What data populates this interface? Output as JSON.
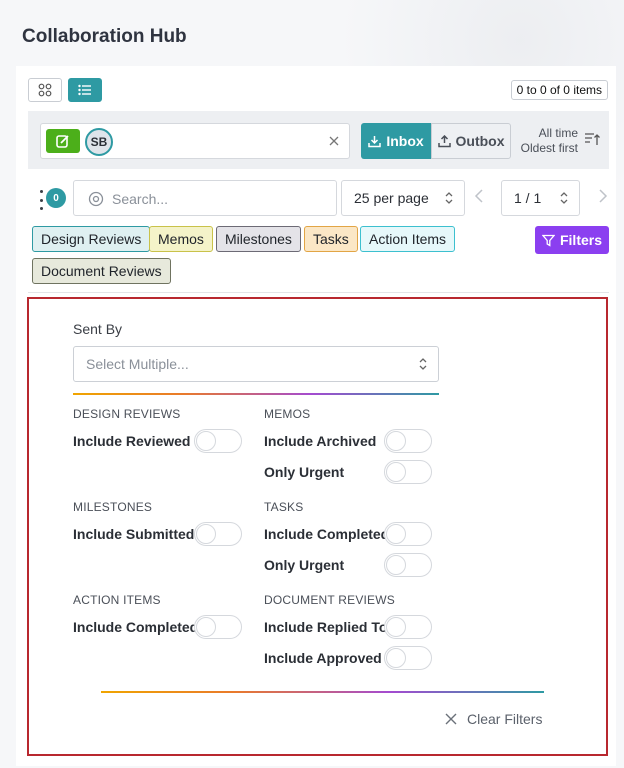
{
  "app": {
    "title": "Collaboration Hub"
  },
  "toolbar": {
    "items_count": "0 to 0 of 0 items",
    "accent_color": "#2e9aa3"
  },
  "recipients": {
    "avatar_initials": "SB",
    "inbox_label": "Inbox",
    "outbox_label": "Outbox",
    "sort_range": "All time",
    "sort_order": "Oldest first"
  },
  "search": {
    "placeholder": "Search...",
    "value": "",
    "filter_count": "0"
  },
  "pagination": {
    "per_page": "25 per page",
    "page": "1 / 1"
  },
  "chips": [
    {
      "label": "Design Reviews",
      "bg": "#dff0f1",
      "border": "#2e9aa3"
    },
    {
      "label": "Memos",
      "bg": "#f4f3c9",
      "border": "#c9c24a"
    },
    {
      "label": "Milestones",
      "bg": "#e4e3e8",
      "border": "#6c6a75"
    },
    {
      "label": "Tasks",
      "bg": "#fbe7c6",
      "border": "#e2a545"
    },
    {
      "label": "Action Items",
      "bg": "#e6f8fa",
      "border": "#3cc0cf"
    },
    {
      "label": "Document Reviews",
      "bg": "#e7e9dc",
      "border": "#6f7360"
    }
  ],
  "filters_button": {
    "label": "Filters",
    "color": "#8b3ff0"
  },
  "filter_panel": {
    "sent_by_label": "Sent By",
    "sent_by_placeholder": "Select Multiple...",
    "sections": {
      "design_reviews": {
        "title": "DESIGN REVIEWS",
        "options": [
          "Include Reviewed"
        ]
      },
      "memos": {
        "title": "MEMOS",
        "options": [
          "Include Archived",
          "Only Urgent"
        ]
      },
      "milestones": {
        "title": "MILESTONES",
        "options": [
          "Include Submitted"
        ]
      },
      "tasks": {
        "title": "TASKS",
        "options": [
          "Include Completed",
          "Only Urgent"
        ]
      },
      "action_items": {
        "title": "ACTION ITEMS",
        "options": [
          "Include Completed"
        ]
      },
      "document_reviews": {
        "title": "DOCUMENT REVIEWS",
        "options": [
          "Include Replied To",
          "Include Approved"
        ]
      }
    },
    "clear_label": "Clear Filters"
  }
}
